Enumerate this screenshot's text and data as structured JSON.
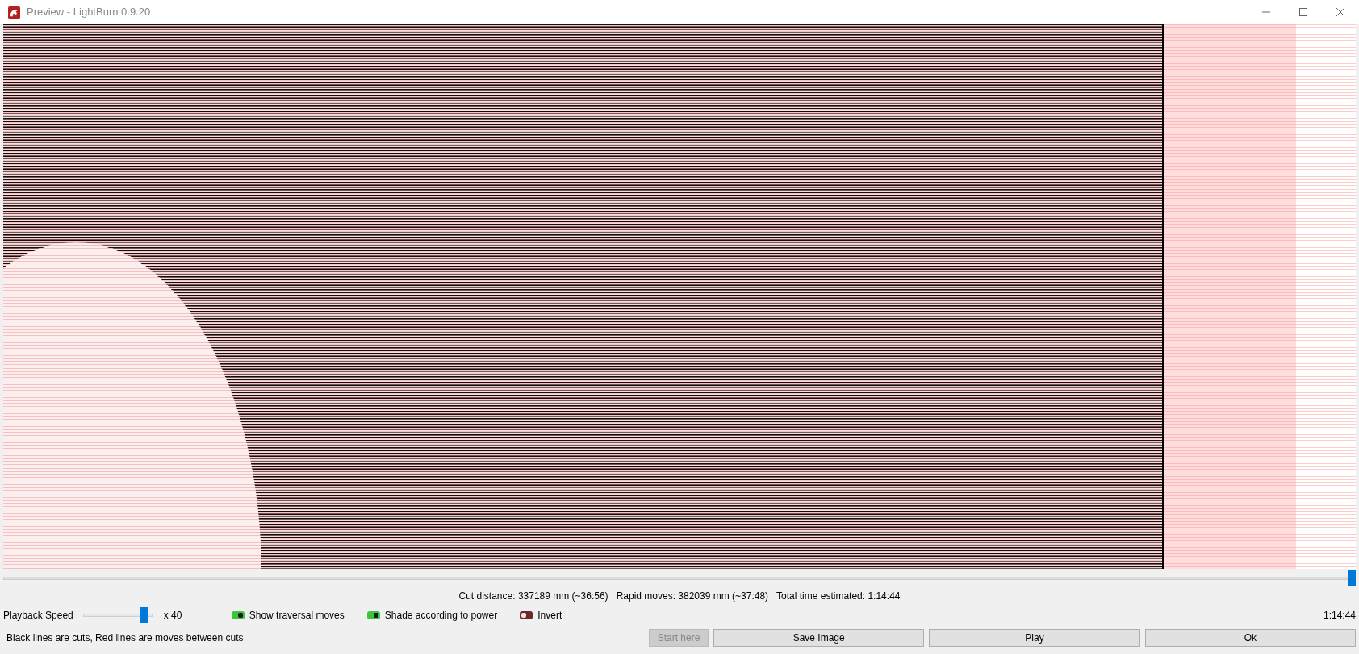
{
  "window": {
    "title": "Preview - LightBurn 0.9.20"
  },
  "timeline": {
    "level": 1
  },
  "stats": [
    "Cut distance: 337189 mm (~36:56)",
    "Rapid moves: 382039 mm (~37:48)",
    "Total time estimated: 1:14:44"
  ],
  "playback": {
    "label": "Playback Speed",
    "level": 0.92,
    "multiplier": "x 40"
  },
  "toggles": [
    {
      "label": "Show traversal moves",
      "on": true
    },
    {
      "label": "Shade according to power",
      "on": true
    },
    {
      "label": "Invert",
      "on": false
    }
  ],
  "elapsed_time": "1:14:44",
  "legend": "Black lines are cuts, Red lines are moves between cuts",
  "buttons": [
    {
      "label": "Start here",
      "disabled": true
    },
    {
      "label": "Save Image",
      "disabled": false
    },
    {
      "label": "Play",
      "disabled": false
    },
    {
      "label": "Ok",
      "disabled": false
    }
  ]
}
